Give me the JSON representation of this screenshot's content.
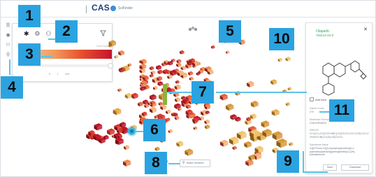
{
  "header": {
    "logo_text": "CAS",
    "logo_subtext": "SciFinder"
  },
  "colors": {
    "callout": "#2ba3e0",
    "leader": "#5cc3e8",
    "heat_low": "#f5c89a",
    "heat_high": "#c4142b",
    "cube_gold": "#e0a44a",
    "selected": "#3cb4d8"
  },
  "toolbar_icons": [
    "list-icon",
    "palette-icon",
    "person-icon",
    "search-icon"
  ],
  "filter_panel": {
    "icons": [
      "asterisk-icon",
      "settings-icon",
      "person-icon",
      "zoom-icon"
    ],
    "scale_label": "Color Scale",
    "min_value": "0",
    "low_value": "1",
    "high_value": "100",
    "filter_icon": "filter-icon"
  },
  "detail_panel": {
    "compound_name": "Olaparib",
    "registry_number": "763113-22-0",
    "add_label": "Add Item",
    "fields": [
      {
        "label": "Patent Count",
        "value": "272"
      },
      {
        "label": "Molecular Formula",
        "value": "C24H23FN4O3"
      },
      {
        "label": "SMILES",
        "value": "O=C(C1=CC(CC2=NNC(=O)C3=CC=CC=C23)=CC=C1F)N1CCN(CC1)C(=O)C1CC1"
      },
      {
        "label": "Substance Name",
        "value": "4-[[4-Fluoro-3-[[4-(cyclopropylcarbonyl)-1-piperazinyl]carbonyl]phenyl]methyl]-1(2H)-phthalazinone"
      }
    ],
    "save_label": "Save",
    "download_label": "Download"
  },
  "select_structure": {
    "label": "Select Structure",
    "icon": "magnifier-icon"
  },
  "callouts": [
    "1",
    "2",
    "3",
    "4",
    "5",
    "6",
    "7",
    "8",
    "9",
    "10",
    "11"
  ]
}
